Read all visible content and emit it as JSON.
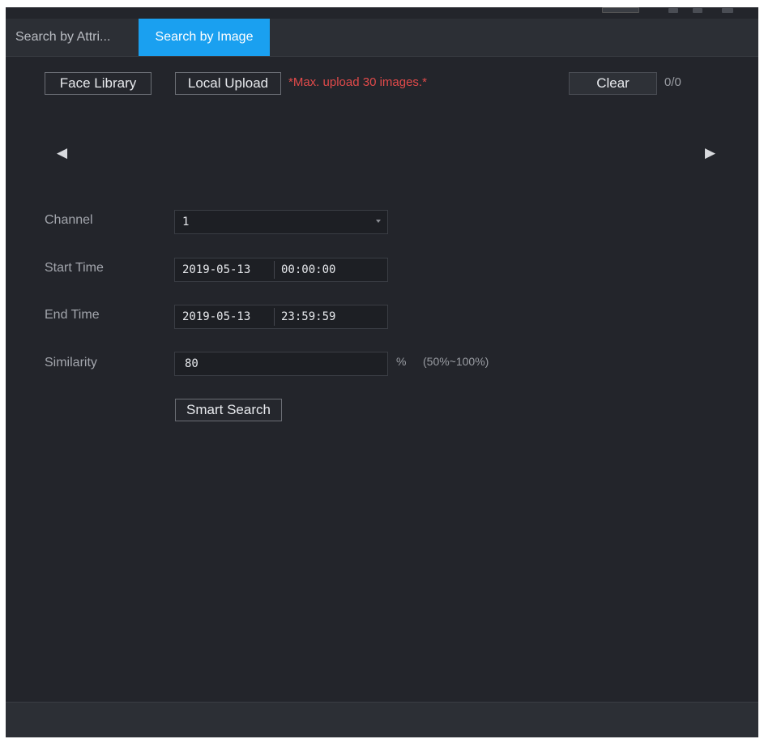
{
  "tabs": [
    {
      "label": "Search by Attri...",
      "active": false
    },
    {
      "label": "Search by Image",
      "active": true
    }
  ],
  "toolbar": {
    "face_library_label": "Face Library",
    "local_upload_label": "Local Upload",
    "upload_hint": "*Max. upload 30 images.*",
    "clear_label": "Clear",
    "image_count": "0/0"
  },
  "carousel": {
    "prev_icon": "◀",
    "next_icon": "▶"
  },
  "form": {
    "channel_label": "Channel",
    "channel_value": "1",
    "start_time_label": "Start Time",
    "start_date": "2019-05-13",
    "start_time": "00:00:00",
    "end_time_label": "End Time",
    "end_date": "2019-05-13",
    "end_time": "23:59:59",
    "similarity_label": "Similarity",
    "similarity_value": "80",
    "similarity_unit": "%",
    "similarity_range": "(50%~100%)",
    "smart_search_label": "Smart Search"
  },
  "colors": {
    "active_tab": "#1aa0f0",
    "background": "#23252b",
    "hint": "#e04a4a"
  }
}
